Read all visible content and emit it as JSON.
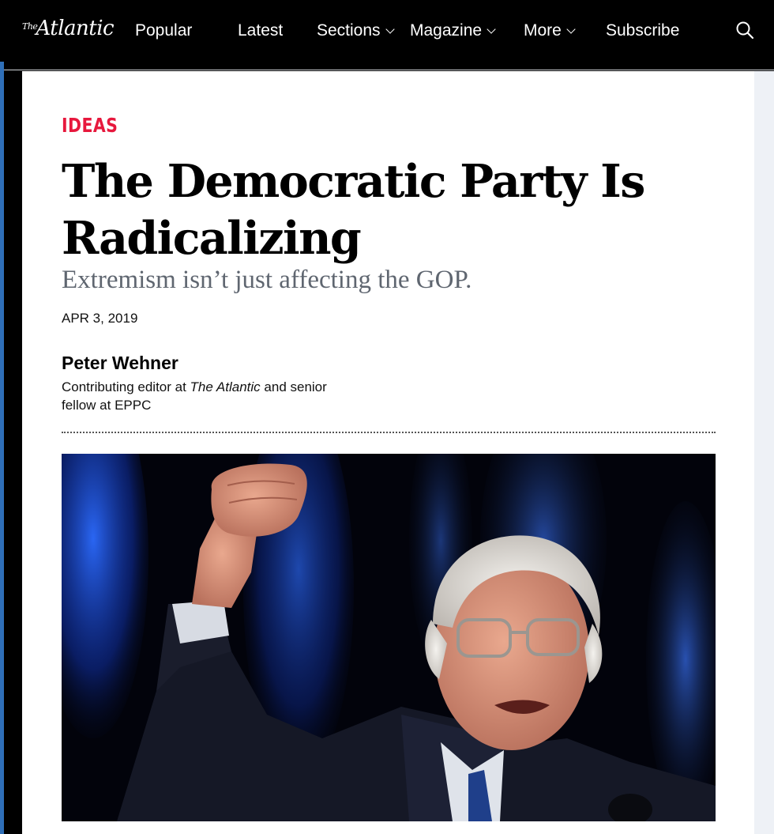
{
  "navbar": {
    "logo_the": "The",
    "logo_main": "Atlantic",
    "items": [
      {
        "label": "Popular"
      },
      {
        "label": "Latest"
      },
      {
        "label": "Sections"
      },
      {
        "label": "Magazine"
      },
      {
        "label": "More"
      },
      {
        "label": "Subscribe"
      }
    ],
    "search_icon": "search-icon"
  },
  "article": {
    "section": "IDEAS",
    "headline": "The Democratic Party Is Radicalizing",
    "subheadline": "Extremism isn’t just affecting the GOP.",
    "date": "APR 3, 2019",
    "author": {
      "name": "Peter Wehner",
      "bio_before": "Contributing editor at ",
      "bio_publication": "The Atlantic",
      "bio_after": " and senior fellow at EPPC"
    }
  },
  "colors": {
    "accent": "#e7183d",
    "navbar_bg": "#000000",
    "subheadline": "#5f6670",
    "left_rail": "#2f6fb8"
  }
}
